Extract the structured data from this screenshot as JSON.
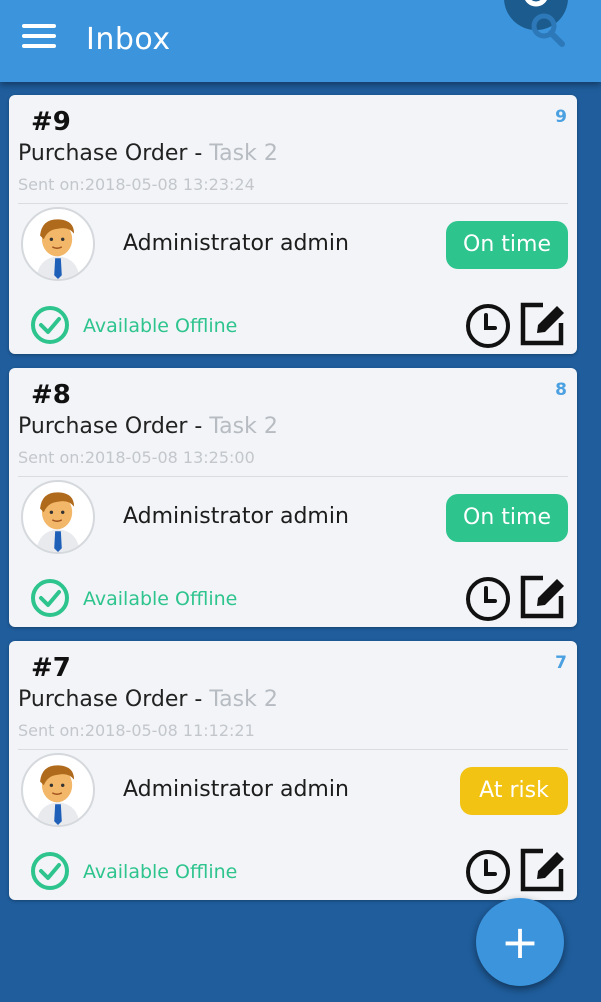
{
  "header": {
    "title": "Inbox",
    "menu_icon": "menu-icon",
    "search_icon": "search-icon",
    "bar_color": "#3b94dc"
  },
  "cards": [
    {
      "case_no": "#9",
      "count": "9",
      "process": "Purchase Order - ",
      "task": "Task 2",
      "sent": "Sent on:2018-05-08 13:23:24",
      "user": "Administrator admin",
      "status": "On time",
      "status_color": "#2ec48e",
      "offline": "Available Offline"
    },
    {
      "case_no": "#8",
      "count": "8",
      "process": "Purchase Order - ",
      "task": "Task 2",
      "sent": "Sent on:2018-05-08 13:25:00",
      "user": "Administrator admin",
      "status": "On time",
      "status_color": "#2ec48e",
      "offline": "Available Offline"
    },
    {
      "case_no": "#7",
      "count": "7",
      "process": "Purchase Order - ",
      "task": "Task 2",
      "sent": "Sent on:2018-05-08 11:12:21",
      "user": "Administrator admin",
      "status": "At risk",
      "status_color": "#f2c313",
      "offline": "Available Offline"
    }
  ],
  "fab": {
    "label": "+",
    "icon": "plus-icon"
  }
}
